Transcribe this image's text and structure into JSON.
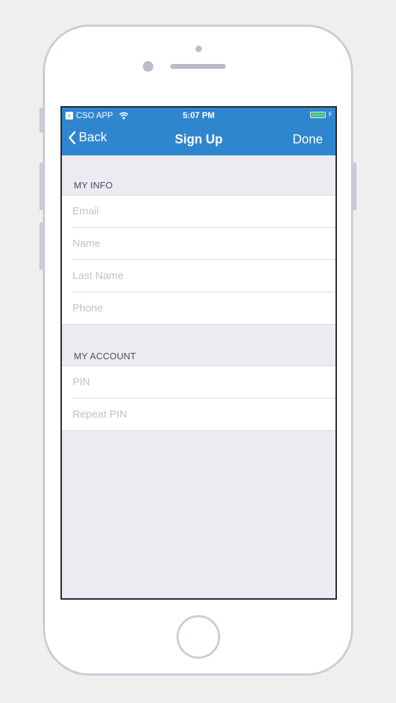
{
  "status_bar": {
    "carrier": "CSO APP",
    "time": "5:07 PM",
    "battery_color": "#4cd964"
  },
  "nav": {
    "back_label": "Back",
    "title": "Sign Up",
    "done_label": "Done",
    "bar_color": "#2f86cf"
  },
  "sections": {
    "my_info": {
      "header": "MY INFO",
      "fields": [
        {
          "placeholder": "Email",
          "value": ""
        },
        {
          "placeholder": "Name",
          "value": ""
        },
        {
          "placeholder": "Last Name",
          "value": ""
        },
        {
          "placeholder": "Phone",
          "value": ""
        }
      ]
    },
    "my_account": {
      "header": "MY ACCOUNT",
      "fields": [
        {
          "placeholder": "PIN",
          "value": ""
        },
        {
          "placeholder": "Repeat PIN",
          "value": ""
        }
      ]
    }
  },
  "icons": {
    "back_app": "back-to-app-icon",
    "wifi": "wifi-icon",
    "battery": "battery-icon",
    "charging": "charging-bolt-icon",
    "back_chevron": "chevron-left-icon"
  }
}
